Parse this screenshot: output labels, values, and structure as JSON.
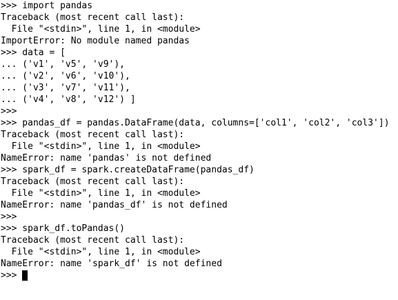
{
  "terminal": {
    "lines": [
      ">>> import pandas",
      "Traceback (most recent call last):",
      "  File \"<stdin>\", line 1, in <module>",
      "ImportError: No module named pandas",
      ">>> data = [",
      "... ('v1', 'v5', 'v9'),",
      "... ('v2', 'v6', 'v10'),",
      "... ('v3', 'v7', 'v11'),",
      "... ('v4', 'v8', 'v12') ]",
      ">>>",
      ">>> pandas_df = pandas.DataFrame(data, columns=['col1', 'col2', 'col3'])",
      "Traceback (most recent call last):",
      "  File \"<stdin>\", line 1, in <module>",
      "NameError: name 'pandas' is not defined",
      ">>> spark_df = spark.createDataFrame(pandas_df)",
      "Traceback (most recent call last):",
      "  File \"<stdin>\", line 1, in <module>",
      "NameError: name 'pandas_df' is not defined",
      ">>>",
      ">>> spark_df.toPandas()",
      "Traceback (most recent call last):",
      "  File \"<stdin>\", line 1, in <module>",
      "NameError: name 'spark_df' is not defined"
    ],
    "prompt": ">>> "
  }
}
